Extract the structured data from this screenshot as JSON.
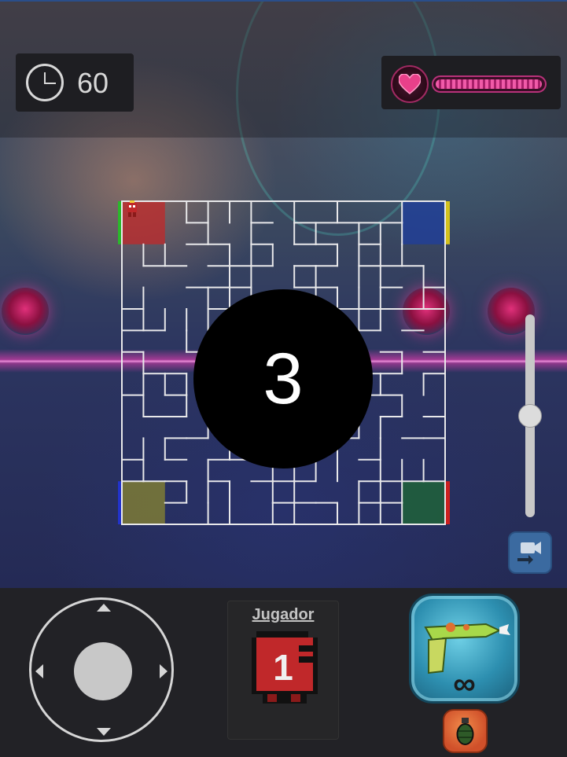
{
  "hud": {
    "timer_value": "60",
    "health_fraction": 0.98
  },
  "countdown": {
    "value": "3"
  },
  "zoom": {
    "level_fraction": 0.5
  },
  "player": {
    "label": "Jugador",
    "number": "1"
  },
  "weapon": {
    "ammo": "∞"
  },
  "icons": {
    "timer": "clock-icon",
    "health": "heart-icon",
    "camera_switch": "camera-switch-icon",
    "weapon": "raygun-icon",
    "grenade": "grenade-icon"
  },
  "colors": {
    "player1": "#c0282a",
    "player2": "#1f3e9e",
    "player3": "#8a8630",
    "player4": "#1f6a34",
    "maze_wall": "#e8e8ea"
  }
}
